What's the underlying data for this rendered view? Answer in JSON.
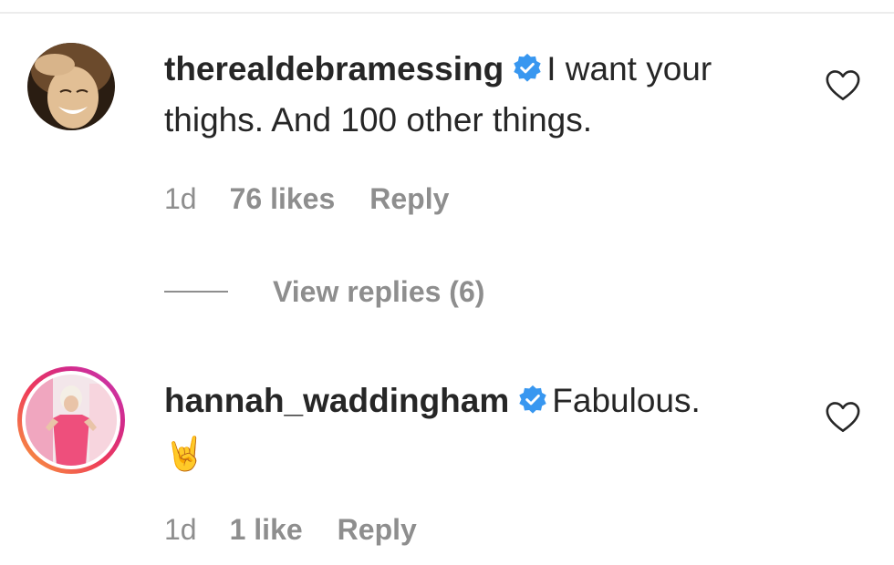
{
  "comments": [
    {
      "username": "therealdebramessing",
      "verified": true,
      "text": "I want your thighs. And 100 other things.",
      "emoji": "",
      "time": "1d",
      "likes": "76 likes",
      "reply_label": "Reply",
      "view_replies_label": "View replies (6)"
    },
    {
      "username": "hannah_waddingham",
      "verified": true,
      "text": "Fabulous.",
      "emoji": "🤘",
      "time": "1d",
      "likes": "1 like",
      "reply_label": "Reply"
    }
  ],
  "icons": {
    "verified": "verified-badge-icon",
    "like": "heart-icon"
  },
  "colors": {
    "text": "#262626",
    "secondary": "#8e8e8e",
    "verified": "#3897f0",
    "story_ring_start": "#f9a23b",
    "story_ring_end": "#c73ab8"
  }
}
